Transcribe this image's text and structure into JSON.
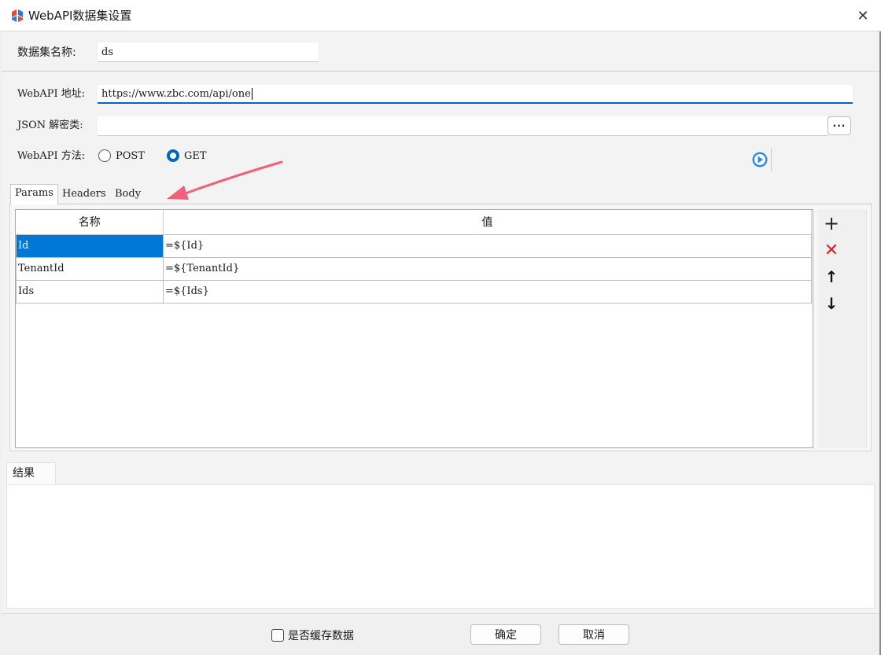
{
  "window": {
    "title": "WebAPI数据集设置",
    "close_glyph": "✕"
  },
  "dataset": {
    "name_label": "数据集名称:",
    "name_value": "ds"
  },
  "webapi": {
    "url_label": "WebAPI 地址:",
    "url_value": "https://www.zbc.com/api/one",
    "decrypt_label": "JSON 解密类:",
    "decrypt_value": "",
    "browse_label": "···",
    "method_label": "WebAPI 方法:",
    "method_options": [
      "POST",
      "GET"
    ],
    "method_selected": "GET"
  },
  "tabs": [
    "Params",
    "Headers",
    "Body"
  ],
  "active_tab": "Params",
  "params": {
    "columns": [
      "名称",
      "值"
    ],
    "rows": [
      {
        "name": "Id",
        "value": "=${Id}"
      },
      {
        "name": "TenantId",
        "value": "=${TenantId}"
      },
      {
        "name": "Ids",
        "value": "=${Ids}"
      }
    ]
  },
  "toolbar": {
    "add": "+",
    "delete": "✕",
    "up": "↑",
    "down": "↓"
  },
  "result": {
    "tab_label": "结果",
    "content": ""
  },
  "footer": {
    "cache_label": "是否缓存数据",
    "cache_checked": false,
    "ok_label": "确定",
    "cancel_label": "取消"
  },
  "colors": {
    "accent": "#0067c0",
    "selection": "#0078d7",
    "delete": "#e02020",
    "annotation_arrow": "#f0607a"
  }
}
